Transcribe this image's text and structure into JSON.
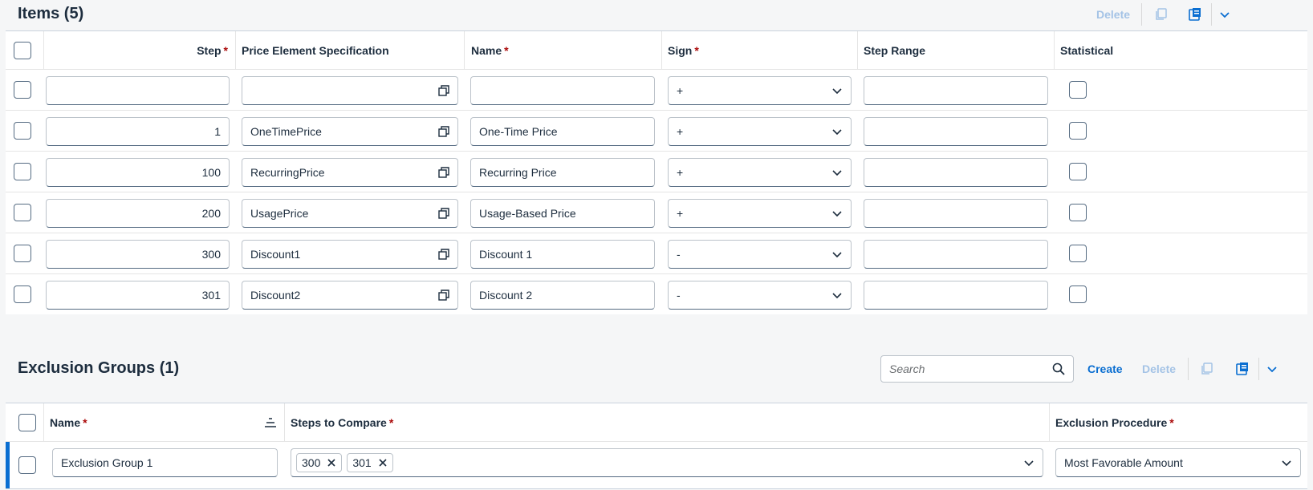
{
  "items_section": {
    "title": "Items (5)",
    "toolbar": {
      "delete_label": "Delete"
    },
    "columns": {
      "step": "Step",
      "price_element": "Price Element Specification",
      "name": "Name",
      "sign": "Sign",
      "step_range": "Step Range",
      "statistical": "Statistical"
    },
    "rows": [
      {
        "step": "",
        "price_element": "",
        "name": "",
        "sign": "+",
        "step_range": ""
      },
      {
        "step": "1",
        "price_element": "OneTimePrice",
        "name": "One-Time Price",
        "sign": "+",
        "step_range": ""
      },
      {
        "step": "100",
        "price_element": "RecurringPrice",
        "name": "Recurring Price",
        "sign": "+",
        "step_range": ""
      },
      {
        "step": "200",
        "price_element": "UsagePrice",
        "name": "Usage-Based Price",
        "sign": "+",
        "step_range": ""
      },
      {
        "step": "300",
        "price_element": "Discount1",
        "name": "Discount 1",
        "sign": "-",
        "step_range": ""
      },
      {
        "step": "301",
        "price_element": "Discount2",
        "name": "Discount 2",
        "sign": "-",
        "step_range": ""
      }
    ]
  },
  "exclusion_section": {
    "title": "Exclusion Groups (1)",
    "search": {
      "placeholder": "Search"
    },
    "toolbar": {
      "create_label": "Create",
      "delete_label": "Delete"
    },
    "columns": {
      "name": "Name",
      "steps_to_compare": "Steps to Compare",
      "exclusion_procedure": "Exclusion Procedure"
    },
    "rows": [
      {
        "name": "Exclusion Group 1",
        "steps": [
          "300",
          "301"
        ],
        "procedure": "Most Favorable Amount"
      }
    ]
  },
  "colors": {
    "accent": "#0a6ed1",
    "required": "#aa0808",
    "disabled": "#a4c3e6"
  },
  "icons": [
    "copy-icon",
    "paste-icon",
    "chevron-down-icon",
    "value-help-icon",
    "search-icon",
    "sort-icon",
    "close-icon"
  ]
}
